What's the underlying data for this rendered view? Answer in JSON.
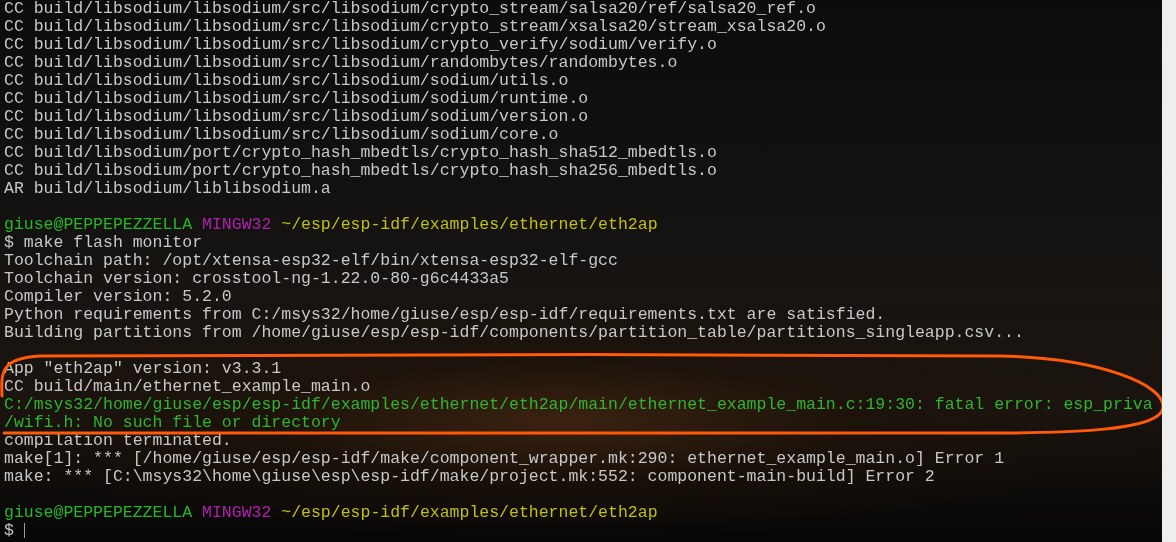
{
  "terminal": {
    "lines": [
      {
        "kind": "output",
        "text": "CC build/libsodium/libsodium/src/libsodium/crypto_stream/salsa20/ref/salsa20_ref.o"
      },
      {
        "kind": "output",
        "text": "CC build/libsodium/libsodium/src/libsodium/crypto_stream/xsalsa20/stream_xsalsa20.o"
      },
      {
        "kind": "output",
        "text": "CC build/libsodium/libsodium/src/libsodium/crypto_verify/sodium/verify.o"
      },
      {
        "kind": "output",
        "text": "CC build/libsodium/libsodium/src/libsodium/randombytes/randombytes.o"
      },
      {
        "kind": "output",
        "text": "CC build/libsodium/libsodium/src/libsodium/sodium/utils.o"
      },
      {
        "kind": "output",
        "text": "CC build/libsodium/libsodium/src/libsodium/sodium/runtime.o"
      },
      {
        "kind": "output",
        "text": "CC build/libsodium/libsodium/src/libsodium/sodium/version.o"
      },
      {
        "kind": "output",
        "text": "CC build/libsodium/libsodium/src/libsodium/sodium/core.o"
      },
      {
        "kind": "output",
        "text": "CC build/libsodium/port/crypto_hash_mbedtls/crypto_hash_sha512_mbedtls.o"
      },
      {
        "kind": "output",
        "text": "CC build/libsodium/port/crypto_hash_mbedtls/crypto_hash_sha256_mbedtls.o"
      },
      {
        "kind": "output",
        "text": "AR build/libsodium/liblibsodium.a"
      },
      {
        "kind": "blank"
      },
      {
        "kind": "prompt",
        "user": "giuse@PEPPEPEZZELLA",
        "system": "MINGW32",
        "path": "~/esp/esp-idf/examples/ethernet/eth2ap"
      },
      {
        "kind": "command",
        "text": "$ make flash monitor"
      },
      {
        "kind": "output",
        "text": "Toolchain path: /opt/xtensa-esp32-elf/bin/xtensa-esp32-elf-gcc"
      },
      {
        "kind": "output",
        "text": "Toolchain version: crosstool-ng-1.22.0-80-g6c4433a5"
      },
      {
        "kind": "output",
        "text": "Compiler version: 5.2.0"
      },
      {
        "kind": "output",
        "text": "Python requirements from C:/msys32/home/giuse/esp/esp-idf/requirements.txt are satisfied."
      },
      {
        "kind": "output",
        "text": "Building partitions from /home/giuse/esp/esp-idf/components/partition_table/partitions_singleapp.csv..."
      },
      {
        "kind": "blank"
      },
      {
        "kind": "output",
        "text": "App \"eth2ap\" version: v3.3.1"
      },
      {
        "kind": "output",
        "text": "CC build/main/ethernet_example_main.o"
      },
      {
        "kind": "error",
        "text": "C:/msys32/home/giuse/esp/esp-idf/examples/ethernet/eth2ap/main/ethernet_example_main.c:19:30: fatal error: esp_priva"
      },
      {
        "kind": "error",
        "text": "/wifi.h: No such file or directory"
      },
      {
        "kind": "output",
        "text": "compilation terminated."
      },
      {
        "kind": "output",
        "text": "make[1]: *** [/home/giuse/esp/esp-idf/make/component_wrapper.mk:290: ethernet_example_main.o] Error 1"
      },
      {
        "kind": "output",
        "text": "make: *** [C:\\msys32\\home\\giuse\\esp\\esp-idf/make/project.mk:552: component-main-build] Error 2"
      },
      {
        "kind": "blank"
      },
      {
        "kind": "prompt",
        "user": "giuse@PEPPEPEZZELLA",
        "system": "MINGW32",
        "path": "~/esp/esp-idf/examples/ethernet/eth2ap"
      },
      {
        "kind": "input",
        "text": "$"
      }
    ]
  }
}
